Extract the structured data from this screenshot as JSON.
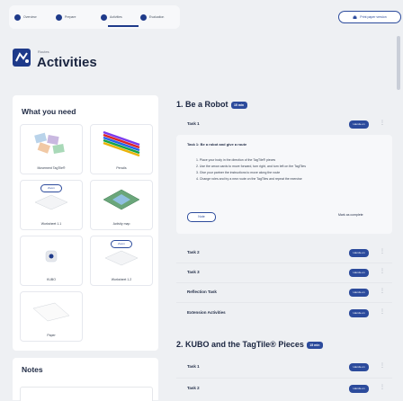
{
  "tabs": [
    {
      "label": "Overview"
    },
    {
      "label": "Prepare"
    },
    {
      "label": "Activities"
    },
    {
      "label": "Evaluation"
    }
  ],
  "print_button": "Print paper version",
  "heading": {
    "eyebrow": "Routes",
    "title": "Activities"
  },
  "what_you_need": {
    "title": "What you need",
    "zoom_label": "Zoom",
    "items": [
      {
        "label": "Movement TagTile®"
      },
      {
        "label": "Pencils"
      },
      {
        "label": "Worksheet 1.1"
      },
      {
        "label": "Activity map"
      },
      {
        "label": "KUBO"
      },
      {
        "label": "Worksheet 1.2"
      },
      {
        "label": "Paper"
      }
    ]
  },
  "notes": {
    "title": "Notes"
  },
  "sections": [
    {
      "title": "1. Be a Robot",
      "badge": "15 min",
      "tasks": [
        "Task 1",
        "Task 2",
        "Task 3",
        "Reflection Task",
        "Extension Activities"
      ],
      "expanded": {
        "intro": "Task 1: Be a robot and give a route",
        "steps": [
          "1. Place your body in the direction of the TagTile® pieces",
          "2. Use the arrow cards to move forward, turn right, and turn left on the TagTiles",
          "3. Give your partner the instructions to move along the route",
          "4. Change roles and try a new route on the TagTiles and repeat the exercise"
        ],
        "note_button": "Note",
        "complete_button": "Mark as complete"
      }
    },
    {
      "title": "2. KUBO and the TagTile® Pieces",
      "badge": "15 min",
      "tasks": [
        "Task 1",
        "Task 2"
      ]
    }
  ],
  "hands_on_label": "Hands-on",
  "more_glyph": "⋮"
}
